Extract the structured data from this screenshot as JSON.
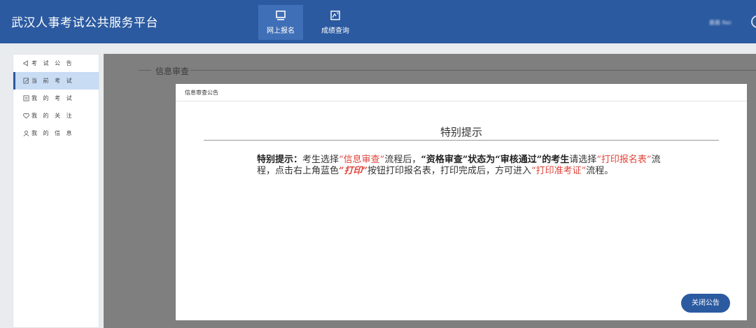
{
  "header": {
    "app_title": "武汉人事考试公共服务平台",
    "nav": [
      {
        "label": "网上报名",
        "icon": "monitor-icon",
        "active": true
      },
      {
        "label": "成绩查询",
        "icon": "score-search-icon",
        "active": false
      }
    ],
    "user_name": "晨晨 Nei"
  },
  "sidebar": {
    "items": [
      {
        "label": "考 试 公 告",
        "icon": "megaphone-icon",
        "active": false
      },
      {
        "label": "当 前 考 试",
        "icon": "edit-icon",
        "active": true
      },
      {
        "label": "我 的 考 试",
        "icon": "document-icon",
        "active": false
      },
      {
        "label": "我 的 关 注",
        "icon": "heart-icon",
        "active": false
      },
      {
        "label": "我 的 信 息",
        "icon": "user-icon",
        "active": false
      }
    ]
  },
  "main": {
    "section_title": "信息审查"
  },
  "modal": {
    "header_title": "信息审查公告",
    "heading": "特别提示",
    "notice": {
      "p1": "特别提示：",
      "p2": "考生选择",
      "p3": "“信息审查”",
      "p4": "流程后，",
      "p5": "“资格审查”状态为“审核通过”的考生",
      "p6": "请选择",
      "p7": "“打印报名表”",
      "p8": "流程，点击右上角蓝色",
      "p9": "”打印”",
      "p10": "按钮打印报名表，打印完成后，方可进入",
      "p11": "“打印准考证”",
      "p12": "流程。"
    },
    "close_label": "关闭公告"
  },
  "colors": {
    "brand": "#2b5aa0",
    "highlight_red": "#e0433a",
    "sidebar_active": "#c8dcf4",
    "overlay": "#7f7f7f"
  }
}
